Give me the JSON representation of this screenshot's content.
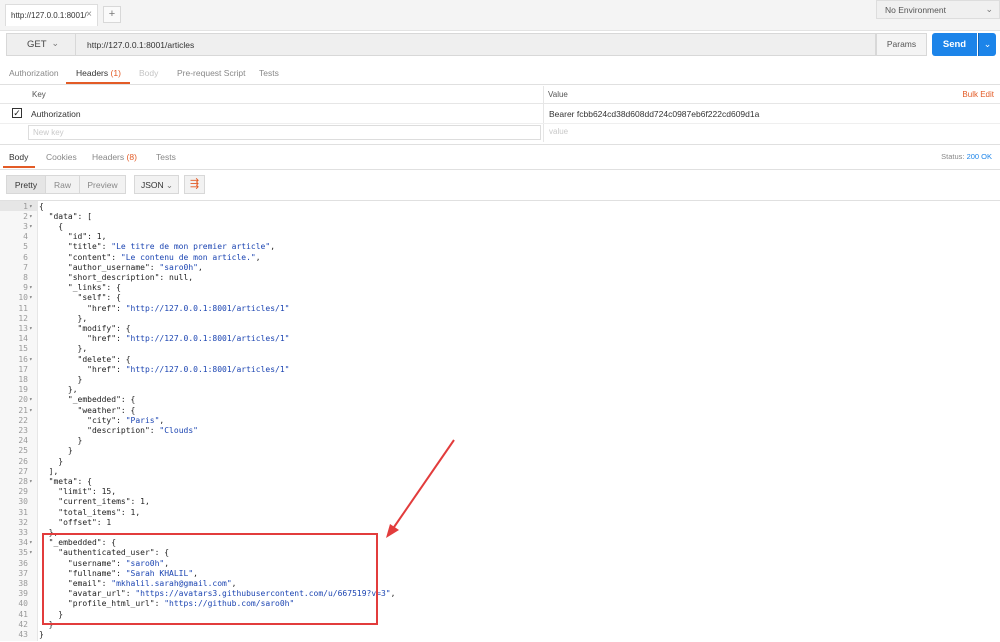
{
  "topbar": {
    "tab_title": "http://127.0.0.1:8001/",
    "tab_close": "×",
    "new_tab": "+",
    "environment": "No Environment",
    "environment_caret": "⌄"
  },
  "request": {
    "method": "GET",
    "method_caret": "⌄",
    "url": "http://127.0.0.1:8001/articles",
    "params_label": "Params",
    "send_label": "Send",
    "send_caret": "⌄"
  },
  "request_tabs": [
    {
      "label": "Authorization"
    },
    {
      "label": "Headers",
      "badge": "(1)"
    },
    {
      "label": "Body"
    },
    {
      "label": "Pre-request Script"
    },
    {
      "label": "Tests"
    }
  ],
  "headers_table": {
    "key_header": "Key",
    "value_header": "Value",
    "bulk_edit": "Bulk Edit",
    "rows": [
      {
        "checked": true,
        "check_glyph": "✓",
        "key": "Authorization",
        "value": "Bearer fcbb624cd38d608dd724c0987eb6f222cd609d1a"
      }
    ],
    "new_key_placeholder": "New key",
    "new_value_placeholder": "value"
  },
  "response_tabs": [
    {
      "label": "Body"
    },
    {
      "label": "Cookies"
    },
    {
      "label": "Headers",
      "badge": "(8)"
    },
    {
      "label": "Tests"
    }
  ],
  "status": {
    "label": "Status:",
    "value": "200 OK"
  },
  "view_buttons": {
    "pretty": "Pretty",
    "raw": "Raw",
    "preview": "Preview",
    "format": "JSON",
    "format_caret": "⌄",
    "wrap_icon": "⇶"
  },
  "code_lines": [
    {
      "n": "1",
      "fold": "▾",
      "t": "{"
    },
    {
      "n": "2",
      "fold": "▾",
      "t": "  \"data\": ["
    },
    {
      "n": "3",
      "fold": "▾",
      "t": "    {"
    },
    {
      "n": "4",
      "fold": "",
      "t": "      \"id\": 1,"
    },
    {
      "n": "5",
      "fold": "",
      "t": "      \"title\": \"Le titre de mon premier article\","
    },
    {
      "n": "6",
      "fold": "",
      "t": "      \"content\": \"Le contenu de mon article.\","
    },
    {
      "n": "7",
      "fold": "",
      "t": "      \"author_username\": \"saro0h\","
    },
    {
      "n": "8",
      "fold": "",
      "t": "      \"short_description\": null,"
    },
    {
      "n": "9",
      "fold": "▾",
      "t": "      \"_links\": {"
    },
    {
      "n": "10",
      "fold": "▾",
      "t": "        \"self\": {"
    },
    {
      "n": "11",
      "fold": "",
      "t": "          \"href\": \"http://127.0.0.1:8001/articles/1\""
    },
    {
      "n": "12",
      "fold": "",
      "t": "        },"
    },
    {
      "n": "13",
      "fold": "▾",
      "t": "        \"modify\": {"
    },
    {
      "n": "14",
      "fold": "",
      "t": "          \"href\": \"http://127.0.0.1:8001/articles/1\""
    },
    {
      "n": "15",
      "fold": "",
      "t": "        },"
    },
    {
      "n": "16",
      "fold": "▾",
      "t": "        \"delete\": {"
    },
    {
      "n": "17",
      "fold": "",
      "t": "          \"href\": \"http://127.0.0.1:8001/articles/1\""
    },
    {
      "n": "18",
      "fold": "",
      "t": "        }"
    },
    {
      "n": "19",
      "fold": "",
      "t": "      },"
    },
    {
      "n": "20",
      "fold": "▾",
      "t": "      \"_embedded\": {"
    },
    {
      "n": "21",
      "fold": "▾",
      "t": "        \"weather\": {"
    },
    {
      "n": "22",
      "fold": "",
      "t": "          \"city\": \"Paris\","
    },
    {
      "n": "23",
      "fold": "",
      "t": "          \"description\": \"Clouds\""
    },
    {
      "n": "24",
      "fold": "",
      "t": "        }"
    },
    {
      "n": "25",
      "fold": "",
      "t": "      }"
    },
    {
      "n": "26",
      "fold": "",
      "t": "    }"
    },
    {
      "n": "27",
      "fold": "",
      "t": "  ],"
    },
    {
      "n": "28",
      "fold": "▾",
      "t": "  \"meta\": {"
    },
    {
      "n": "29",
      "fold": "",
      "t": "    \"limit\": 15,"
    },
    {
      "n": "30",
      "fold": "",
      "t": "    \"current_items\": 1,"
    },
    {
      "n": "31",
      "fold": "",
      "t": "    \"total_items\": 1,"
    },
    {
      "n": "32",
      "fold": "",
      "t": "    \"offset\": 1"
    },
    {
      "n": "33",
      "fold": "",
      "t": "  },"
    },
    {
      "n": "34",
      "fold": "▾",
      "t": "  \"_embedded\": {"
    },
    {
      "n": "35",
      "fold": "▾",
      "t": "    \"authenticated_user\": {"
    },
    {
      "n": "36",
      "fold": "",
      "t": "      \"username\": \"saro0h\","
    },
    {
      "n": "37",
      "fold": "",
      "t": "      \"fullname\": \"Sarah KHALIL\","
    },
    {
      "n": "38",
      "fold": "",
      "t": "      \"email\": \"mkhalil.sarah@gmail.com\","
    },
    {
      "n": "39",
      "fold": "",
      "t": "      \"avatar_url\": \"https://avatars3.githubusercontent.com/u/667519?v=3\","
    },
    {
      "n": "40",
      "fold": "",
      "t": "      \"profile_html_url\": \"https://github.com/saro0h\""
    },
    {
      "n": "41",
      "fold": "",
      "t": "    }"
    },
    {
      "n": "42",
      "fold": "",
      "t": "  }"
    },
    {
      "n": "43",
      "fold": "",
      "t": "}"
    }
  ],
  "colors": {
    "accent": "#e35b26",
    "send": "#1c84e9",
    "annotation": "#e23c3c",
    "string": "#1c45b2"
  }
}
